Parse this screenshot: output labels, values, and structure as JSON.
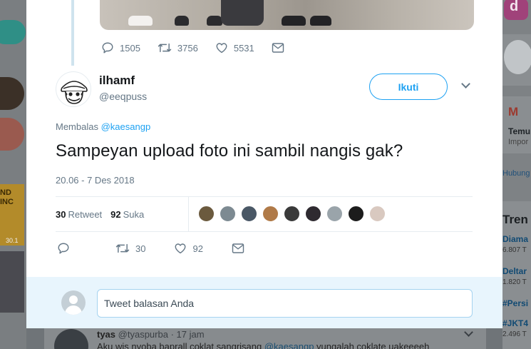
{
  "background": {
    "right_rail": {
      "letter": "d",
      "gmail_title": "Temu",
      "gmail_sub": "Impor",
      "link": "Hubung",
      "trends_title": "Tren",
      "trends": [
        {
          "name": "Diama",
          "count": "6.807 T"
        },
        {
          "name": "Deltar",
          "count": "1.820 T"
        },
        {
          "name": "#Persi",
          "count": ""
        },
        {
          "name": "#JKT4",
          "count": "2.496 T"
        }
      ]
    },
    "left_rail": {
      "promo_text": "ND\nINC",
      "promo_num": "30.1"
    },
    "next_tweet": {
      "name": "tyas",
      "handle": "@tyaspurba",
      "time": "· 17 jam",
      "text_before": "Aku wis nyoba baprall coklat sangrisang ",
      "mention": "@kaesangp",
      "text_after": " yungalah coklate uakeeeeh"
    }
  },
  "previous_tweet": {
    "replies": "1505",
    "retweets": "3756",
    "likes": "5531"
  },
  "tweet": {
    "display_name": "ilhamf",
    "handle": "@eeqpuss",
    "follow_label": "Ikuti",
    "reply_prefix": "Membalas",
    "reply_mention": "@kaesangp",
    "text": "Sampeyan upload foto ini sambil nangis gak?",
    "timestamp": "20.06 - 7 Des 2018",
    "retweet_count": "30",
    "retweet_label": "Retweet",
    "like_count": "92",
    "like_label": "Suka",
    "action_retweets": "30",
    "action_likes": "92"
  },
  "liker_colors": [
    "#6b5a3e",
    "#7d8a92",
    "#4a5866",
    "#b07a48",
    "#3a3a3a",
    "#2e2a30",
    "#9aa4aa",
    "#1c1c1c",
    "#d9c9c0"
  ],
  "reply_box": {
    "placeholder": "Tweet balasan Anda"
  },
  "colors": {
    "accent": "#1da1f2",
    "secondary_text": "#657786",
    "reply_area_bg": "#e8f5fd"
  }
}
